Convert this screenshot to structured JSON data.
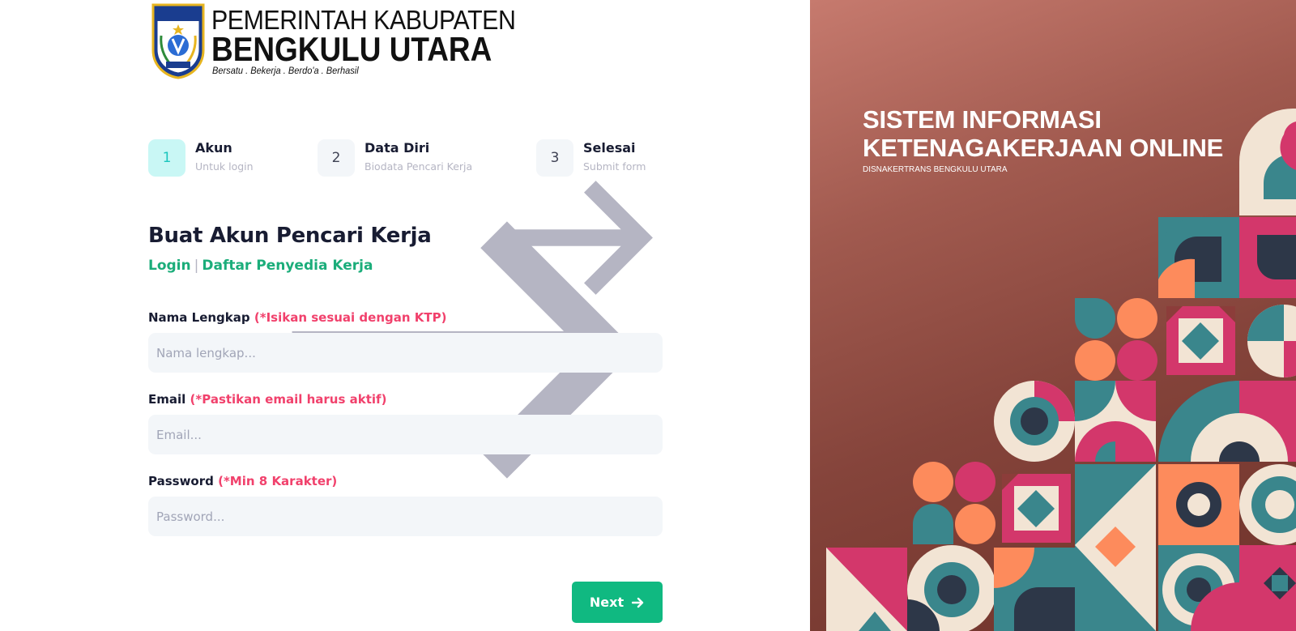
{
  "logo": {
    "line1": "PEMERINTAH KABUPATEN",
    "line2": "BENGKULU UTARA",
    "tagline": "Bersatu . Bekerja . Berdo'a . Berhasil",
    "crest_text": "KABUPATEN BENGKULU UTARA"
  },
  "steps": [
    {
      "number": "1",
      "title": "Akun",
      "description": "Untuk login"
    },
    {
      "number": "2",
      "title": "Data Diri",
      "description": "Biodata Pencari Kerja"
    },
    {
      "number": "3",
      "title": "Selesai",
      "description": "Submit form"
    }
  ],
  "form": {
    "title": "Buat Akun Pencari Kerja",
    "login_link": "Login",
    "separator": "|",
    "employer_link": "Daftar Penyedia Kerja",
    "name": {
      "label": "Nama Lengkap",
      "hint": "(*Isikan sesuai dengan KTP)",
      "placeholder": "Nama lengkap...",
      "value": ""
    },
    "email": {
      "label": "Email",
      "hint": "(*Pastikan email harus aktif)",
      "placeholder": "Email...",
      "value": ""
    },
    "password": {
      "label": "Password",
      "hint": "(*Min 8 Karakter)",
      "placeholder": "Password...",
      "value": ""
    },
    "next_label": "Next"
  },
  "hero": {
    "title": "SISTEM INFORMASI KETENAGAKERJAAN ONLINE",
    "subtitle": "DISNAKERTRANS BENGKULU UTARA"
  },
  "colors": {
    "accent_green": "#10b981",
    "link_green": "#1bad7a",
    "hint_red": "#f1416c",
    "step_active_bg": "#c9f7f5",
    "step_active_text": "#1bc5bd",
    "pattern_teal": "#3a868c",
    "pattern_pink": "#d3376b",
    "pattern_orange": "#fd8b5c",
    "pattern_navy": "#2d3748",
    "pattern_cream": "#f2e4d4"
  },
  "icons": {
    "step_arrow": "arrow-right-icon",
    "next_arrow": "arrow-right-bold-icon",
    "crest": "regency-crest-icon"
  }
}
